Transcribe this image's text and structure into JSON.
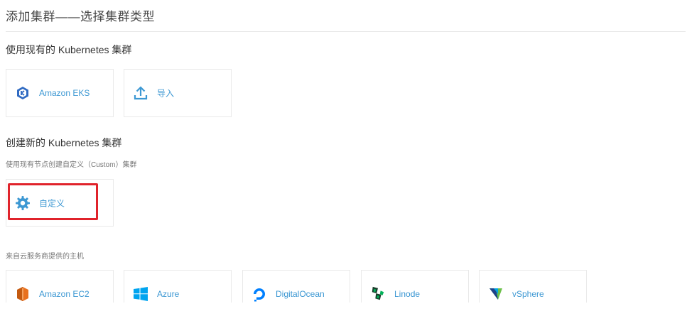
{
  "page": {
    "title": "添加集群——选择集群类型"
  },
  "sections": {
    "existing": {
      "title": "使用现有的 Kubernetes 集群",
      "cards": [
        {
          "label": "Amazon EKS",
          "icon": "eks-icon"
        },
        {
          "label": "导入",
          "icon": "upload-icon"
        }
      ]
    },
    "create": {
      "title": "创建新的 Kubernetes 集群",
      "subtitle": "使用现有节点创建自定义（Custom）集群",
      "cards": [
        {
          "label": "自定义",
          "icon": "gear-icon"
        }
      ]
    },
    "cloud": {
      "subtitle": "来自云服务商提供的主机",
      "cards": [
        {
          "label": "Amazon EC2",
          "icon": "ec2-icon"
        },
        {
          "label": "Azure",
          "icon": "azure-icon"
        },
        {
          "label": "DigitalOcean",
          "icon": "digitalocean-icon"
        },
        {
          "label": "Linode",
          "icon": "linode-icon"
        },
        {
          "label": "vSphere",
          "icon": "vsphere-icon"
        }
      ]
    }
  },
  "colors": {
    "link": "#3d98d3",
    "highlight": "#e0232b",
    "aws_orange": "#e8711f",
    "azure_blue": "#00a4ef",
    "do_blue": "#0080ff",
    "linode_green": "#02b159",
    "eks_blue": "#2f6ac2"
  }
}
